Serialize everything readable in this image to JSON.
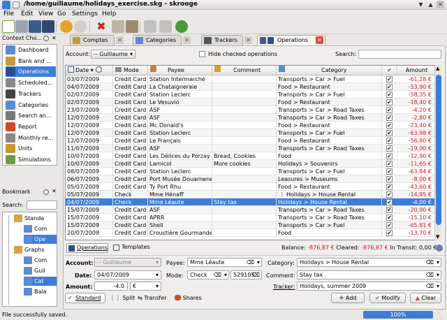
{
  "window": {
    "title": "/home/guillaume/holidays_exercise.skg - skrooge"
  },
  "menu": [
    "File",
    "Edit",
    "View",
    "Go",
    "Settings",
    "Help"
  ],
  "context_panel": {
    "title": "Context Cho...",
    "items": [
      {
        "label": "Dashboard",
        "icon": "dashboard-icon",
        "color": "#5b8bd0"
      },
      {
        "label": "Bank and ...",
        "icon": "bank-icon",
        "color": "#c59a3a"
      },
      {
        "label": "Operations",
        "icon": "operations-icon",
        "color": "#2c4f8a"
      },
      {
        "label": "Scheduled...",
        "icon": "clock-icon",
        "color": "#888"
      },
      {
        "label": "Trackers",
        "icon": "trackers-icon",
        "color": "#444"
      },
      {
        "label": "Categories",
        "icon": "categories-icon",
        "color": "#5b8bd0"
      },
      {
        "label": "Search an...",
        "icon": "search-icon",
        "color": "#777"
      },
      {
        "label": "Report",
        "icon": "report-icon",
        "color": "#d04a2a"
      },
      {
        "label": "Monthly re...",
        "icon": "monthly-report-icon",
        "color": "#888"
      },
      {
        "label": "Units",
        "icon": "units-icon",
        "color": "#c89a2a"
      },
      {
        "label": "Simulations",
        "icon": "simulations-icon",
        "color": "#6b9b4a"
      }
    ]
  },
  "bookmark_panel": {
    "title": "Bookmark",
    "search_label": "Search:",
    "tree": [
      {
        "label": "Standa",
        "level": 1
      },
      {
        "label": "Com",
        "level": 2
      },
      {
        "label": "Ope",
        "level": 2,
        "selected": true
      },
      {
        "label": "Graphs",
        "level": 1
      },
      {
        "label": "Com",
        "level": 2
      },
      {
        "label": "Guil",
        "level": 2
      },
      {
        "label": "Cat",
        "level": 2,
        "selected": true
      },
      {
        "label": "Bala",
        "level": 2
      }
    ]
  },
  "tabs": [
    {
      "label": "Comptes"
    },
    {
      "label": "Categories"
    },
    {
      "label": "Trackers"
    },
    {
      "label": "Operations",
      "active": true
    }
  ],
  "filter": {
    "account_label": "Account:",
    "account_value": "-- Guillaume",
    "hide_checked_label": "Hide checked operations",
    "search_label": "Search:"
  },
  "table": {
    "headers": [
      "Date",
      "Mode",
      "Payee",
      "Comment",
      "Category",
      "",
      "Amount"
    ],
    "rows": [
      {
        "date": "03/07/2009",
        "mode": "Credit Card",
        "payee": "Station Intermarché",
        "comment": "",
        "category": "Transports > Car > Fuel",
        "amount": "-61,28 €"
      },
      {
        "date": "04/07/2009",
        "mode": "Credit Card",
        "payee": "La Chataigneraie",
        "comment": "",
        "category": "Food > Restaurant",
        "amount": "-53,90 €"
      },
      {
        "date": "02/07/2009",
        "mode": "Credit Card",
        "payee": "Station Leclerc",
        "comment": "",
        "category": "Transports > Car > Fuel",
        "amount": "-58,35 €"
      },
      {
        "date": "02/07/2009",
        "mode": "Credit Card",
        "payee": "Le Vesuvio",
        "comment": "",
        "category": "Food > Restaurant",
        "amount": "-18,40 €"
      },
      {
        "date": "23/07/2009",
        "mode": "Credit Card",
        "payee": "ASF",
        "comment": "",
        "category": "Transports > Car > Road Taxes",
        "amount": "-4,20 €"
      },
      {
        "date": "12/07/2009",
        "mode": "Credit Card",
        "payee": "ASF",
        "comment": "",
        "category": "Transports > Car > Road Taxes",
        "amount": "-2,80 €"
      },
      {
        "date": "12/07/2009",
        "mode": "Credit Card",
        "payee": "Mc Donald's",
        "comment": "",
        "category": "Food > Restaurant",
        "amount": "-23,40 €"
      },
      {
        "date": "12/07/2009",
        "mode": "Credit Card",
        "payee": "Station Leclerc",
        "comment": "",
        "category": "Transports > Car > Fuel",
        "amount": "-63,98 €"
      },
      {
        "date": "12/07/2009",
        "mode": "Credit Card",
        "payee": "Le Français",
        "comment": "",
        "category": "Food > Restaurant",
        "amount": "-56,80 €"
      },
      {
        "date": "11/07/2009",
        "mode": "Credit Card",
        "payee": "ASF",
        "comment": "",
        "category": "Transports > Car > Road Taxes",
        "amount": "-19,00 €"
      },
      {
        "date": "10/07/2009",
        "mode": "Credit Card",
        "payee": "Les Délices du Porzay",
        "comment": "Bread, Cookies",
        "category": "Food",
        "amount": "-12,90 €"
      },
      {
        "date": "10/07/2009",
        "mode": "Credit Card",
        "payee": "Larnicol",
        "comment": "More cookies",
        "category": "Holidays > Souvenirs",
        "amount": "-11,65 €"
      },
      {
        "date": "08/07/2009",
        "mode": "Credit Card",
        "payee": "Station Leclerc",
        "comment": "",
        "category": "Transports > Car > Fuel",
        "amount": "-63,84 €"
      },
      {
        "date": "06/07/2009",
        "mode": "Credit Card",
        "payee": "Port Musée Douarnenez",
        "comment": "",
        "category": "Leasures > Museums",
        "amount": "-8,00 €"
      },
      {
        "date": "05/07/2009",
        "mode": "Credit Card",
        "payee": "Ty Port Rhu",
        "comment": "",
        "category": "Food > Restaurant",
        "amount": "-43,60 €"
      },
      {
        "date": "05/07/2009",
        "mode": "Check",
        "payee": "Mme Hénaff",
        "comment": "",
        "category": "Holidays > House Rental",
        "amount": "-14,85 €"
      },
      {
        "date": "04/07/2009",
        "mode": "Check",
        "payee": "Mme Léaute",
        "comment": "Stay tax",
        "category": "Holidays > House Rental",
        "amount": "-4,00 €",
        "selected": true
      },
      {
        "date": "15/07/2009",
        "mode": "Credit Card",
        "payee": "ASF",
        "comment": "",
        "category": "Transports > Car > Road Taxes",
        "amount": "-20,90 €"
      },
      {
        "date": "15/07/2009",
        "mode": "Credit Card",
        "payee": "APRR",
        "comment": "",
        "category": "Transports > Car > Road Taxes",
        "amount": "-15,10 €"
      },
      {
        "date": "15/07/2009",
        "mode": "Credit Card",
        "payee": "Shell",
        "comment": "",
        "category": "Transports > Car > Fuel",
        "amount": "-65,81 €"
      },
      {
        "date": "20/07/2009",
        "mode": "Credit Card",
        "payee": "Croustière Gourmande",
        "comment": "",
        "category": "Food",
        "amount": "-13,70 €"
      }
    ]
  },
  "bottom_tabs": {
    "operations": "Operations",
    "templates": "Templates"
  },
  "balance": {
    "balance_label": "Balance:",
    "balance_value": "-876,87 €",
    "cleared_label": "Cleared:",
    "cleared_value": "-876,87 €",
    "transit_label": "In Transit:",
    "transit_value": "0,00 €"
  },
  "editor": {
    "account_label": "Account:",
    "account_value": "-- Guillaume",
    "payee_label": "Payee:",
    "payee_value": "Mme Léaute",
    "category_label": "Category:",
    "category_value": "Holidays > House Rental",
    "date_label": "Date:",
    "date_value": "04/07/2009",
    "mode_label": "Mode:",
    "mode_value": "Check",
    "number_value": "529105",
    "comment_label": "Comment:",
    "comment_value": "Stay tax",
    "amount_label": "Amount:",
    "amount_value": "-4.0",
    "currency_value": "€",
    "tracker_label": "Tracker:",
    "tracker_value": "Holidays, summer 2009"
  },
  "modes": {
    "standard": "Standard",
    "split": "Split",
    "transfer": "Transfer",
    "shares": "Shares"
  },
  "actions": {
    "add": "Add",
    "modify": "Modify",
    "clear": "Clear"
  },
  "status": {
    "message": "File successfully saved.",
    "progress": "100%"
  }
}
